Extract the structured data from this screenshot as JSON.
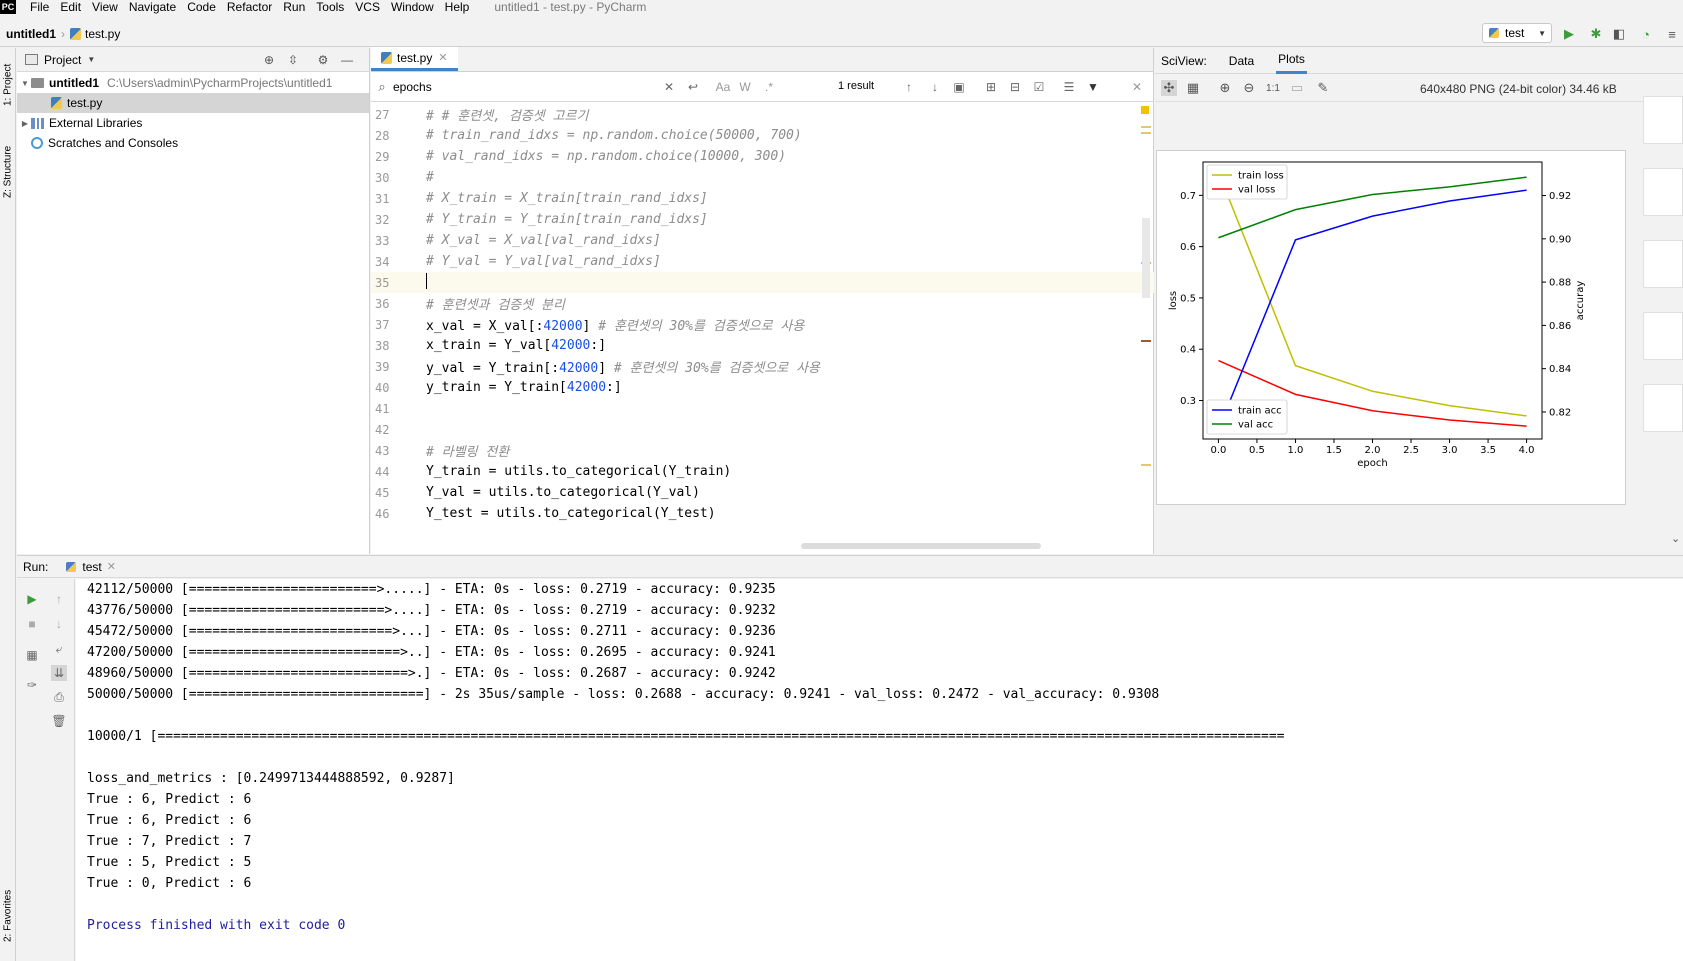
{
  "menubar": {
    "logo": "PC",
    "items": [
      "File",
      "Edit",
      "View",
      "Navigate",
      "Code",
      "Refactor",
      "Run",
      "Tools",
      "VCS",
      "Window",
      "Help"
    ],
    "window_title": "untitled1 - test.py - PyCharm"
  },
  "navbar": {
    "project": "untitled1",
    "file": "test.py",
    "run_config": "test"
  },
  "left_stripe": {
    "project_tab": "1: Project",
    "structure_tab": "Z: Structure",
    "favorites_tab": "2: Favorites"
  },
  "project_panel": {
    "title": "Project",
    "tree": [
      {
        "label": "untitled1",
        "path": "C:\\Users\\admin\\PycharmProjects\\untitled1"
      },
      {
        "label": "test.py"
      },
      {
        "label": "External Libraries"
      },
      {
        "label": "Scratches and Consoles"
      }
    ]
  },
  "editor": {
    "tab_label": "test.py",
    "find": {
      "query": "epochs",
      "result_count": "1 result",
      "match_case": "Aa",
      "words": "W",
      "regex": ".*"
    },
    "lines": [
      {
        "n": "27",
        "parts": [
          {
            "t": "# # 훈련셋, 검증셋 고르기",
            "c": "cmt"
          }
        ]
      },
      {
        "n": "28",
        "parts": [
          {
            "t": "# train_rand_idxs = np.random.choice(50000, 700)",
            "c": "cmt"
          }
        ]
      },
      {
        "n": "29",
        "parts": [
          {
            "t": "# val_rand_idxs = np.random.choice(10000, 300)",
            "c": "cmt"
          }
        ]
      },
      {
        "n": "30",
        "parts": [
          {
            "t": "#",
            "c": "cmt"
          }
        ]
      },
      {
        "n": "31",
        "parts": [
          {
            "t": "# X_train = X_train[train_rand_idxs]",
            "c": "cmt"
          }
        ]
      },
      {
        "n": "32",
        "parts": [
          {
            "t": "# Y_train = Y_train[train_rand_idxs]",
            "c": "cmt"
          }
        ]
      },
      {
        "n": "33",
        "parts": [
          {
            "t": "# X_val = X_val[val_rand_idxs]",
            "c": "cmt"
          }
        ]
      },
      {
        "n": "34",
        "parts": [
          {
            "t": "# Y_val = Y_val[val_rand_idxs]",
            "c": "cmt"
          }
        ]
      },
      {
        "n": "35",
        "parts": [],
        "current": true
      },
      {
        "n": "36",
        "parts": [
          {
            "t": "# 훈련셋과 검증셋 분리",
            "c": "cmt"
          }
        ]
      },
      {
        "n": "37",
        "parts": [
          {
            "t": "x_val = X_val[:",
            "c": ""
          },
          {
            "t": "42000",
            "c": "num"
          },
          {
            "t": "] ",
            "c": ""
          },
          {
            "t": "# 훈련셋의 30%를 검증셋으로 사용",
            "c": "cmt"
          }
        ]
      },
      {
        "n": "38",
        "parts": [
          {
            "t": "x_train = Y_val[",
            "c": ""
          },
          {
            "t": "42000",
            "c": "num"
          },
          {
            "t": ":]",
            "c": ""
          }
        ]
      },
      {
        "n": "39",
        "parts": [
          {
            "t": "y_val = Y_train[:",
            "c": ""
          },
          {
            "t": "42000",
            "c": "num"
          },
          {
            "t": "] ",
            "c": ""
          },
          {
            "t": "# 훈련셋의 30%를 검증셋으로 사용",
            "c": "cmt"
          }
        ]
      },
      {
        "n": "40",
        "parts": [
          {
            "t": "y_train = Y_train[",
            "c": ""
          },
          {
            "t": "42000",
            "c": "num"
          },
          {
            "t": ":]",
            "c": ""
          }
        ]
      },
      {
        "n": "41",
        "parts": []
      },
      {
        "n": "42",
        "parts": []
      },
      {
        "n": "43",
        "parts": [
          {
            "t": "# 라벨링 전환",
            "c": "cmt"
          }
        ]
      },
      {
        "n": "44",
        "parts": [
          {
            "t": "Y_train = utils.to_categorical(Y_train)",
            "c": ""
          }
        ]
      },
      {
        "n": "45",
        "parts": [
          {
            "t": "Y_val = utils.to_categorical(Y_val)",
            "c": ""
          }
        ]
      },
      {
        "n": "46",
        "parts": [
          {
            "t": "Y_test = utils.to_categorical(Y_test)",
            "c": ""
          }
        ]
      }
    ]
  },
  "sciview": {
    "label": "SciView:",
    "tabs": [
      "Data",
      "Plots"
    ],
    "active_tab": "Plots",
    "zoom_actual": "1:1",
    "image_info": "640x480 PNG (24-bit color) 34.46 kB"
  },
  "chart_data": {
    "type": "line",
    "x": [
      0,
      1,
      2,
      3,
      4
    ],
    "xlabel": "epoch",
    "ylabel_left": "loss",
    "ylabel_right": "accuray",
    "xticks": [
      "0.0",
      "0.5",
      "1.0",
      "1.5",
      "2.0",
      "2.5",
      "3.0",
      "3.5",
      "4.0"
    ],
    "yticks_left": [
      "0.3",
      "0.4",
      "0.5",
      "0.6",
      "0.7"
    ],
    "yticks_right": [
      "0.82",
      "0.84",
      "0.86",
      "0.88",
      "0.90",
      "0.92"
    ],
    "ylim_left": [
      0.225,
      0.765
    ],
    "ylim_right": [
      0.8075,
      0.9355
    ],
    "xlim": [
      -0.2,
      4.2
    ],
    "series_left": [
      {
        "name": "train loss",
        "color": "#bfbf00",
        "values": [
          0.745,
          0.368,
          0.318,
          0.29,
          0.27
        ]
      },
      {
        "name": "val loss",
        "color": "#ff0000",
        "values": [
          0.378,
          0.312,
          0.28,
          0.262,
          0.25
        ]
      }
    ],
    "series_right": [
      {
        "name": "train acc",
        "color": "#0000ff",
        "values": [
          0.812,
          0.8995,
          0.9105,
          0.9175,
          0.9225
        ]
      },
      {
        "name": "val acc",
        "color": "#008000",
        "values": [
          0.9005,
          0.9135,
          0.9205,
          0.924,
          0.9285
        ]
      }
    ],
    "legend_left": "top-left",
    "legend_right": "bottom-left"
  },
  "run": {
    "label": "Run:",
    "tab": "test",
    "console": [
      "42112/50000 [========================>.....] - ETA: 0s - loss: 0.2719 - accuracy: 0.9235",
      "43776/50000 [=========================>....] - ETA: 0s - loss: 0.2719 - accuracy: 0.9232",
      "45472/50000 [==========================>...] - ETA: 0s - loss: 0.2711 - accuracy: 0.9236",
      "47200/50000 [===========================>..] - ETA: 0s - loss: 0.2695 - accuracy: 0.9241",
      "48960/50000 [============================>.] - ETA: 0s - loss: 0.2687 - accuracy: 0.9242",
      "50000/50000 [==============================] - 2s 35us/sample - loss: 0.2688 - accuracy: 0.9241 - val_loss: 0.2472 - val_accuracy: 0.9308",
      "",
      "10000/1 [================================================================================================================================================",
      "",
      "loss_and_metrics : [0.2499713444888592, 0.9287]",
      "True : 6, Predict : 6",
      "True : 6, Predict : 6",
      "True : 7, Predict : 7",
      "True : 5, Predict : 5",
      "True : 0, Predict : 6",
      "",
      "Process finished with exit code 0"
    ]
  }
}
